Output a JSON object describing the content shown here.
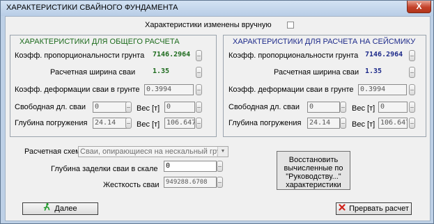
{
  "window": {
    "title": "ХАРАКТЕРИСТИКИ СВАЙНОГО ФУНДАМЕНТА",
    "close_glyph": "X"
  },
  "manual": {
    "label": "Характеристики изменены вручную",
    "checked": false
  },
  "general": {
    "title": "ХАРАКТЕРИСТИКИ ДЛЯ ОБЩЕГО РАСЧЕТА",
    "soil_coef_label": "Коэфф. пропорциональности грунта",
    "soil_coef_value": "7146.2964",
    "pile_width_label": "Расчетная ширина сваи",
    "pile_width_value": "1.35",
    "deform_coef_label": "Коэфф. деформации сваи в грунте",
    "deform_coef_value": "0.3994",
    "free_len_label": "Свободная дл. сваи",
    "free_len_value": "0",
    "weight1_label": "Вес [т]",
    "weight1_value": "0",
    "depth_label": "Глубина погружения",
    "depth_value": "24.14",
    "weight2_label": "Вес [т]",
    "weight2_value": "106.6473"
  },
  "seismic": {
    "title": "ХАРАКТЕРИСТИКИ ДЛЯ РАСЧЕТА НА СЕЙСМИКУ",
    "soil_coef_label": "Коэфф. пропорциональности грунта",
    "soil_coef_value": "7146.2964",
    "pile_width_label": "Расчетная ширина сваи",
    "pile_width_value": "1.35",
    "deform_coef_label": "Коэфф. деформации сваи в грунте",
    "deform_coef_value": "0.3994",
    "free_len_label": "Свободная дл. сваи",
    "free_len_value": "0",
    "weight1_label": "Вес [т]",
    "weight1_value": "0",
    "depth_label": "Глубина погружения",
    "depth_value": "24.14",
    "weight2_label": "Вес [т]",
    "weight2_value": "106.6473"
  },
  "scheme": {
    "label": "Расчетная схема",
    "value": "Сваи, опирающиеся на нескальный грунт"
  },
  "embed": {
    "label": "Глубина заделки сваи в скале",
    "value": "0"
  },
  "stiffness": {
    "label": "Жесткость сваи",
    "value": "949288.6708"
  },
  "restore_button": {
    "line1": "Восстановить",
    "line2": "вычисленные по",
    "line3": "\"Руководству...\"",
    "line4": "характеристики"
  },
  "next_button": {
    "label": "Далее",
    "icon": "runner-icon",
    "icon_color": "#1f9a2a"
  },
  "abort_button": {
    "label": "Прервать расчет",
    "icon": "red-x-icon",
    "icon_color": "#d0221a"
  },
  "colors": {
    "general_title": "#1d6b1d",
    "seismic_title": "#1d2a8a"
  }
}
